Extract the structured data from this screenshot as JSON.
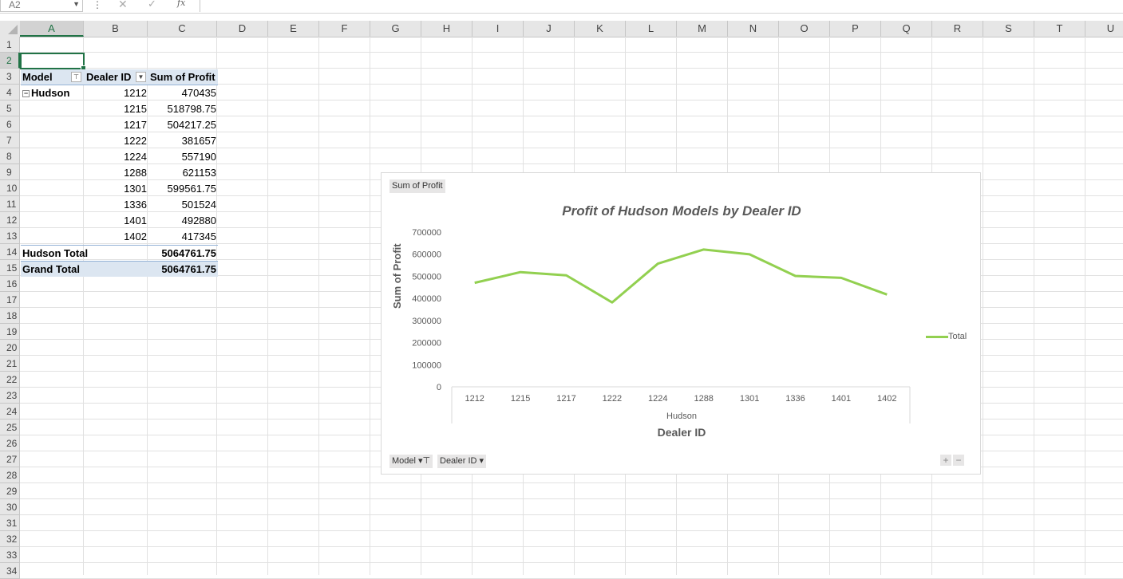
{
  "formula_bar": {
    "name_box": "A2",
    "cancel_icon": "✕",
    "enter_icon": "✓",
    "fx_label": "fx",
    "formula": ""
  },
  "columns": [
    "A",
    "B",
    "C",
    "D",
    "E",
    "F",
    "G",
    "H",
    "I",
    "J",
    "K",
    "L",
    "M",
    "N",
    "O",
    "P",
    "Q",
    "R",
    "S",
    "T",
    "U"
  ],
  "rows": [
    "1",
    "2",
    "3",
    "4",
    "5",
    "6",
    "7",
    "8",
    "9",
    "10",
    "11",
    "12",
    "13",
    "14",
    "15",
    "16",
    "17",
    "18",
    "19",
    "20",
    "21",
    "22",
    "23",
    "24",
    "25",
    "26",
    "27",
    "28",
    "29",
    "30",
    "31",
    "32",
    "33",
    "34"
  ],
  "pivot": {
    "header_model": "Model",
    "header_dealer": "Dealer ID",
    "header_sum": "Sum of Profit",
    "group": "Hudson",
    "rows": [
      {
        "dealer": "1212",
        "profit": "470435"
      },
      {
        "dealer": "1215",
        "profit": "518798.75"
      },
      {
        "dealer": "1217",
        "profit": "504217.25"
      },
      {
        "dealer": "1222",
        "profit": "381657"
      },
      {
        "dealer": "1224",
        "profit": "557190"
      },
      {
        "dealer": "1288",
        "profit": "621153"
      },
      {
        "dealer": "1301",
        "profit": "599561.75"
      },
      {
        "dealer": "1336",
        "profit": "501524"
      },
      {
        "dealer": "1401",
        "profit": "492880"
      },
      {
        "dealer": "1402",
        "profit": "417345"
      }
    ],
    "subtotal_label": "Hudson Total",
    "subtotal_value": "5064761.75",
    "grand_label": "Grand Total",
    "grand_value": "5064761.75"
  },
  "chart_buttons": {
    "value_field": "Sum of Profit",
    "model_field": "Model",
    "dealer_field": "Dealer ID",
    "zoom_in": "+",
    "zoom_out": "−"
  },
  "chart_data": {
    "type": "line",
    "title": "Profit of Hudson Models by Dealer ID",
    "xlabel": "Dealer ID",
    "ylabel": "Sum of Profit",
    "x_group_label": "Hudson",
    "categories": [
      "1212",
      "1215",
      "1217",
      "1222",
      "1224",
      "1288",
      "1301",
      "1336",
      "1401",
      "1402"
    ],
    "series": [
      {
        "name": "Total",
        "values": [
          470435,
          518798.75,
          504217.25,
          381657,
          557190,
          621153,
          599561.75,
          501524,
          492880,
          417345
        ],
        "color": "#92d050"
      }
    ],
    "ylim": [
      0,
      700000
    ],
    "yticks": [
      "0",
      "100000",
      "200000",
      "300000",
      "400000",
      "500000",
      "600000",
      "700000"
    ],
    "grid": false,
    "legend_position": "right"
  }
}
